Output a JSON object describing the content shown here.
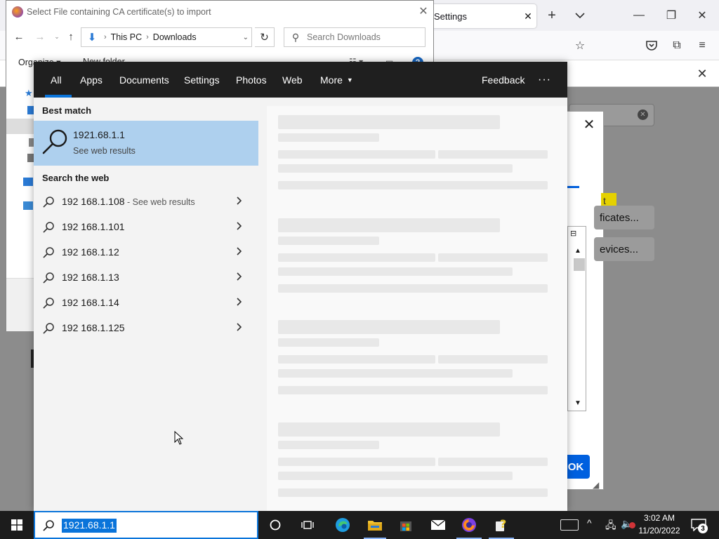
{
  "firefox": {
    "tab_title": "Settings",
    "cert_buttons": {
      "certificates": "ficates...",
      "devices": "evices..."
    },
    "cert_badge": "t",
    "ok_label": "OK"
  },
  "file_dialog": {
    "title": "Select File containing CA certificate(s) to import",
    "address": {
      "this_pc": "This PC",
      "folder": "Downloads"
    },
    "search_placeholder": "Search Downloads",
    "organize": "Organize ▾",
    "new_folder": "New folder"
  },
  "search_panel": {
    "tabs": [
      "All",
      "Apps",
      "Documents",
      "Settings",
      "Photos",
      "Web",
      "More"
    ],
    "feedback": "Feedback",
    "overflow": "···",
    "best_match_label": "Best match",
    "best_match": {
      "title": "1921.68.1.1",
      "subtitle": "See web results"
    },
    "search_web_label": "Search the web",
    "web_results": [
      {
        "text": "192 168.1.108",
        "hint": " - See web results"
      },
      {
        "text": "192 168.1.101",
        "hint": ""
      },
      {
        "text": "192 168.1.12",
        "hint": ""
      },
      {
        "text": "192 168.1.13",
        "hint": ""
      },
      {
        "text": "192 168.1.14",
        "hint": ""
      },
      {
        "text": "192 168.1.125",
        "hint": ""
      }
    ]
  },
  "taskbar": {
    "search_value": "1921.68.1.1",
    "time": "3:02 AM",
    "date": "11/20/2022",
    "notification_count": "3"
  },
  "colors": {
    "accent": "#0a74da",
    "best_match_bg": "#aed0ee",
    "search_header_bg": "#1f1f1f",
    "taskbar_bg": "#1c1c1c"
  }
}
